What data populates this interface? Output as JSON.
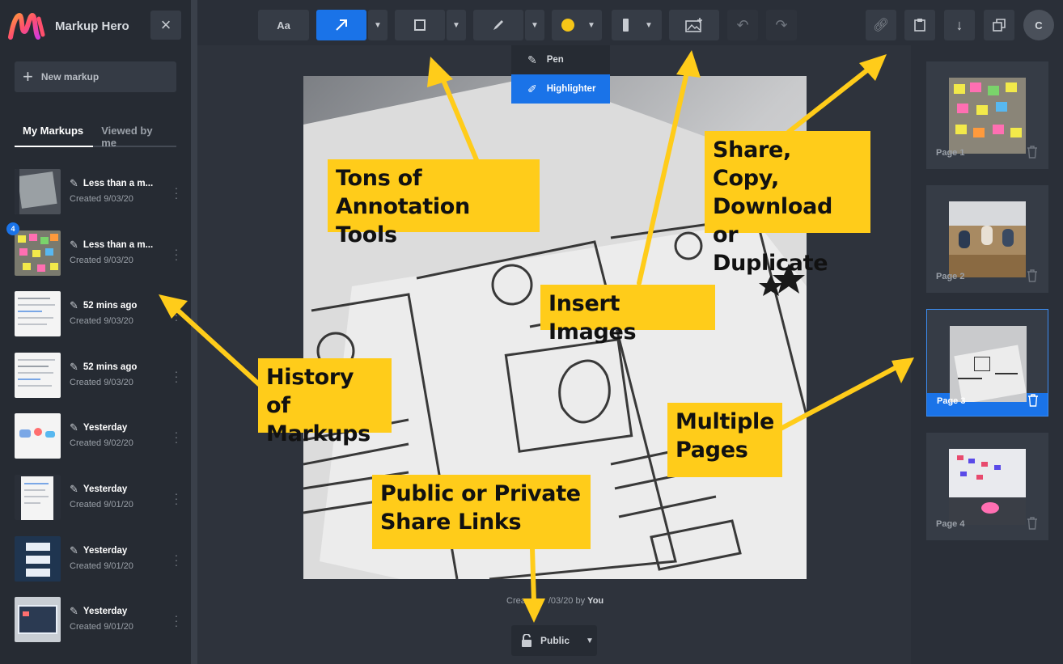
{
  "app": {
    "name": "Markup Hero",
    "avatar_initial": "C"
  },
  "sidebar": {
    "new_markup": "New markup",
    "tabs": [
      "My Markups",
      "Viewed by me"
    ],
    "items": [
      {
        "title": "Less than a m...",
        "created": "Created 9/03/20"
      },
      {
        "title": "Less than a m...",
        "created": "Created 9/03/20",
        "badge": "4"
      },
      {
        "title": "52 mins ago",
        "created": "Created 9/03/20"
      },
      {
        "title": "52 mins ago",
        "created": "Created 9/03/20"
      },
      {
        "title": "Yesterday",
        "created": "Created 9/02/20"
      },
      {
        "title": "Yesterday",
        "created": "Created 9/01/20"
      },
      {
        "title": "Yesterday",
        "created": "Created 9/01/20"
      },
      {
        "title": "Yesterday",
        "created": "Created 9/01/20"
      }
    ]
  },
  "toolbar": {
    "text_tool": "Aa",
    "pen_menu": [
      {
        "label": "Pen"
      },
      {
        "label": "Highlighter"
      }
    ]
  },
  "canvas": {
    "created_prefix": "Crea",
    "created_suffix": "/03/20 by ",
    "created_by": "You",
    "visibility": "Public"
  },
  "pages": [
    {
      "label": "Page 1"
    },
    {
      "label": "Page 2"
    },
    {
      "label": "Page 3"
    },
    {
      "label": "Page 4"
    }
  ],
  "callouts": {
    "tools": [
      "Tons of",
      "Annotation Tools"
    ],
    "share": [
      "Share, Copy,",
      "Download or",
      "Duplicate"
    ],
    "insert": [
      "Insert Images"
    ],
    "history": [
      "History of",
      "Markups"
    ],
    "pages": [
      "Multiple",
      "Pages"
    ],
    "links": [
      "Public or Private",
      "Share Links"
    ]
  },
  "colors": {
    "accent": "#1a73e8",
    "callout": "#ffcc1a",
    "color_swatch": "#f5c518"
  }
}
